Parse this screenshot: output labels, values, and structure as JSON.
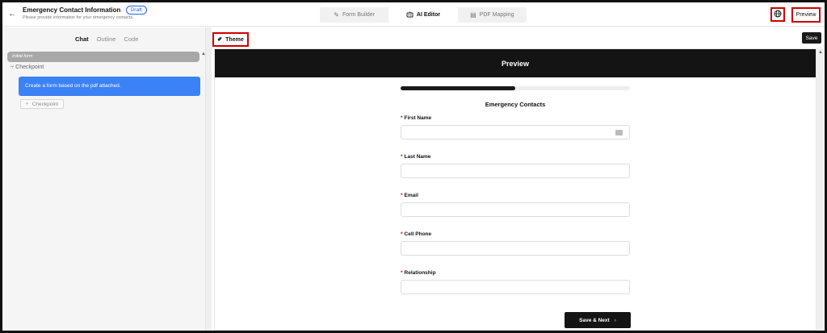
{
  "header": {
    "back_glyph": "←",
    "title": "Emergency Contact Information",
    "status": "Draft",
    "subtitle": "Please provide information for your emergency contacts.",
    "tabs": [
      {
        "label": "Form Builder",
        "icon": "edit-icon",
        "glyph": "✎"
      },
      {
        "label": "AI Editor",
        "icon": "robot-icon",
        "glyph": "🤖"
      },
      {
        "label": "PDF Mapping",
        "icon": "document-icon",
        "glyph": "▤"
      }
    ],
    "active_tab": "AI Editor",
    "globe_glyph": "⊕",
    "preview_label": "Preview"
  },
  "left_panel": {
    "tabs": [
      {
        "label": "Chat"
      },
      {
        "label": "Outline"
      },
      {
        "label": "Code"
      }
    ],
    "active_tab": "Chat",
    "init_label": "Initial form",
    "checkpoint_top": "Checkpoint",
    "message": "Create a form based on the pdf attached.",
    "checkpoint_button": "Checkpoint",
    "checkpoint_glyph": "⑂"
  },
  "toolbar": {
    "theme_label": "Theme",
    "theme_glyph": "✐",
    "save_label": "Save"
  },
  "preview": {
    "header": "Preview",
    "progress": 0.5,
    "section_title": "Emergency Contacts",
    "required_mark": "*",
    "fields": [
      {
        "label": "First Name",
        "value": ""
      },
      {
        "label": "Last Name",
        "value": ""
      },
      {
        "label": "Email",
        "value": ""
      },
      {
        "label": "Cell Phone",
        "value": ""
      },
      {
        "label": "Relationship",
        "value": ""
      }
    ],
    "next_label": "Save & Next",
    "next_glyph": "›"
  },
  "colors": {
    "accent": "#3b82f6",
    "dark": "#141414",
    "highlight_border": "#cc0000"
  }
}
